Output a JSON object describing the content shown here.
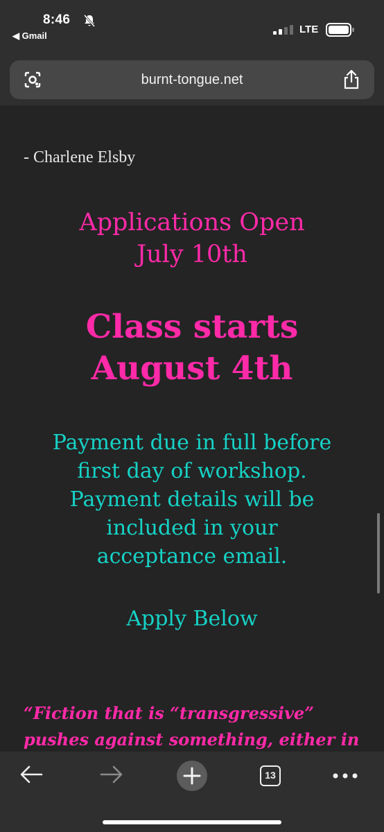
{
  "status_bar": {
    "time": "8:46",
    "back_app": "◀ Gmail",
    "network": "LTE",
    "icons": [
      "bell-slash-icon",
      "signal-icon",
      "battery-icon"
    ]
  },
  "browser": {
    "url": "burnt-tongue.net",
    "icons": [
      "lens-icon",
      "share-icon"
    ]
  },
  "page": {
    "author": "- Charlene Elsby",
    "applications_line1": "Applications Open",
    "applications_line2": "July 10th",
    "class_line1": "Class starts",
    "class_line2": "August 4th",
    "payment_lines": [
      "Payment due in full before",
      "first day of workshop.",
      "Payment details will be",
      "included in your",
      "acceptance email."
    ],
    "apply": "Apply Below",
    "quote_line1": "“Fiction that is “transgressive”",
    "quote_line2": "pushes against something, either in"
  },
  "colors": {
    "pink": "#ff2aa8",
    "teal": "#16d2c6",
    "background": "#242424"
  },
  "toolbar": {
    "tab_count": "13",
    "icons": [
      "back-arrow-icon",
      "forward-arrow-icon",
      "new-tab-icon",
      "tabs-icon",
      "more-icon"
    ]
  }
}
